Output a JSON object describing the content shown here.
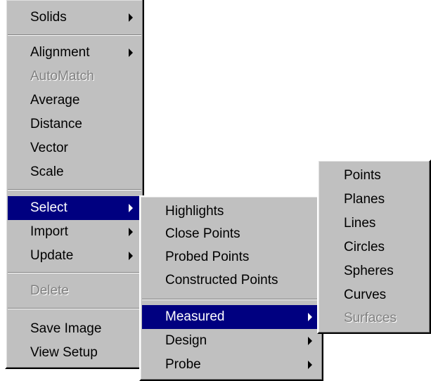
{
  "main_menu": {
    "items": {
      "solids": "Solids",
      "alignment": "Alignment",
      "automatch": "AutoMatch",
      "average": "Average",
      "distance": "Distance",
      "vector": "Vector",
      "scale": "Scale",
      "select": "Select",
      "import": "Import",
      "update": "Update",
      "delete": "Delete",
      "save_image": "Save Image",
      "view_setup": "View Setup"
    }
  },
  "select_submenu": {
    "items": {
      "highlights": "Highlights",
      "close_points": "Close Points",
      "probed_points": "Probed Points",
      "constructed_points": "Constructed Points",
      "measured": "Measured",
      "design": "Design",
      "probe": "Probe"
    }
  },
  "measured_submenu": {
    "items": {
      "points": "Points",
      "planes": "Planes",
      "lines": "Lines",
      "circles": "Circles",
      "spheres": "Spheres",
      "curves": "Curves",
      "surfaces": "Surfaces"
    }
  },
  "colors": {
    "menu_bg": "#c0c0c0",
    "highlight_bg": "#000080",
    "highlight_text": "#ffffff",
    "disabled_text": "#808080"
  }
}
